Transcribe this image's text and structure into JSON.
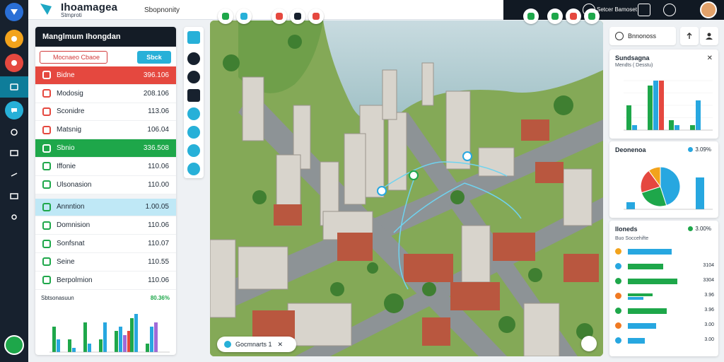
{
  "app": {
    "title": "Ihoamagea",
    "subtitle": "Stmproti"
  },
  "search": {
    "value": "Sbopnonity",
    "placeholder": "Sbopnonity"
  },
  "topbar": {
    "user_label": "Setcer Bamoset"
  },
  "left_panel": {
    "title": "Manglmum Ihongdan",
    "tab_left": "Mocnaeo  Cbaoe",
    "tab_right": "Sbck",
    "rows": [
      {
        "label": "Bidne",
        "value": "396.106",
        "style": "red",
        "icon_color": "#ffffff"
      },
      {
        "label": "Modosig",
        "value": "208.106",
        "style": "none",
        "icon_color": "#e5483f"
      },
      {
        "label": "Sconidre",
        "value": "113.06",
        "style": "none",
        "icon_color": "#e5483f"
      },
      {
        "label": "Matsnig",
        "value": "106.04",
        "style": "none",
        "icon_color": "#e5483f"
      },
      {
        "label": "Sbnio",
        "value": "336.508",
        "style": "green",
        "icon_color": "#ffffff"
      },
      {
        "label": "Iffonie",
        "value": "110.06",
        "style": "none",
        "icon_color": "#1ea74a"
      },
      {
        "label": "Ulsonasion",
        "value": "110.00",
        "style": "none",
        "icon_color": "#1ea74a"
      },
      {
        "label": "Annntion",
        "value": "1.00.05",
        "style": "blue",
        "icon_color": "#1ea74a"
      },
      {
        "label": "Domnision",
        "value": "110.06",
        "style": "none",
        "icon_color": "#1ea74a"
      },
      {
        "label": "Sonfsnat",
        "value": "110.07",
        "style": "none",
        "icon_color": "#1ea74a"
      },
      {
        "label": "Seine",
        "value": "110.55",
        "style": "none",
        "icon_color": "#1ea74a"
      },
      {
        "label": "Berpolmion",
        "value": "110.06",
        "style": "none",
        "icon_color": "#1ea74a"
      }
    ]
  },
  "map": {
    "caption": "Gocmnarts 1"
  },
  "right_panel": {
    "top_label": "Bnnonoss",
    "card1": {
      "title": "Sundsagna",
      "subtitle": "Mendts ( Desstu)"
    },
    "card2": {
      "title": "Deonenoa",
      "value": "3.09%"
    },
    "card3": {
      "title": "Iloneds",
      "value": "3.00%",
      "subtitle": "Buo Soccehifte",
      "rows": [
        {
          "value": "",
          "icon": "#f2a31c",
          "bars": [
            {
              "w": 0.62,
              "c": "#27a7e0"
            }
          ]
        },
        {
          "value": "3104",
          "icon": "#27a7e0",
          "bars": [
            {
              "w": 0.5,
              "c": "#1ea74a"
            }
          ]
        },
        {
          "value": "3304",
          "icon": "#1ea74a",
          "bars": [
            {
              "w": 0.7,
              "c": "#1ea74a"
            }
          ]
        },
        {
          "value": "3.96",
          "icon": "#f07a23",
          "bars": [
            {
              "w": 0.35,
              "c": "#1ea74a"
            },
            {
              "w": 0.22,
              "c": "#27a7e0"
            }
          ]
        },
        {
          "value": "3.96",
          "icon": "#1ea74a",
          "bars": [
            {
              "w": 0.55,
              "c": "#1ea74a"
            }
          ]
        },
        {
          "value": "3.00",
          "icon": "#f07a23",
          "bars": [
            {
              "w": 0.4,
              "c": "#27a7e0"
            }
          ]
        },
        {
          "value": "3.00",
          "icon": "#27a7e0",
          "bars": [
            {
              "w": 0.24,
              "c": "#27a7e0"
            }
          ]
        }
      ]
    }
  },
  "chart_data": [
    {
      "type": "bar",
      "title": "Sbtsonasuun",
      "subtitle": "80.36%",
      "series": [
        {
          "color": "#1ea74a",
          "values": [
            6,
            3,
            7,
            3,
            5,
            8,
            2
          ]
        },
        {
          "color": "#27a7e0",
          "values": [
            3,
            1,
            2,
            7,
            6,
            9,
            6
          ]
        },
        {
          "color": "#a06ad8",
          "values": [
            0,
            0,
            0,
            0,
            4,
            0,
            7
          ]
        },
        {
          "color": "#e5483f",
          "values": [
            0,
            0,
            0,
            0,
            5,
            0,
            0
          ]
        }
      ],
      "ylim": [
        0,
        10
      ]
    },
    {
      "type": "bar",
      "series": [
        {
          "color": "#1ea74a",
          "values": [
            5,
            9,
            2,
            1
          ]
        },
        {
          "color": "#27a7e0",
          "values": [
            1,
            10,
            1,
            6
          ]
        },
        {
          "color": "#e5483f",
          "values": [
            0,
            10,
            0,
            0
          ]
        }
      ],
      "ylim": [
        0,
        10
      ]
    },
    {
      "type": "pie",
      "slices": [
        {
          "value": 45,
          "color": "#27a7e0"
        },
        {
          "value": 25,
          "color": "#1ea74a"
        },
        {
          "value": 20,
          "color": "#e5483f"
        },
        {
          "value": 10,
          "color": "#f2a31c"
        }
      ],
      "bars": [
        {
          "value": 2,
          "color": "#27a7e0"
        },
        {
          "value": 9,
          "color": "#27a7e0"
        }
      ]
    }
  ]
}
